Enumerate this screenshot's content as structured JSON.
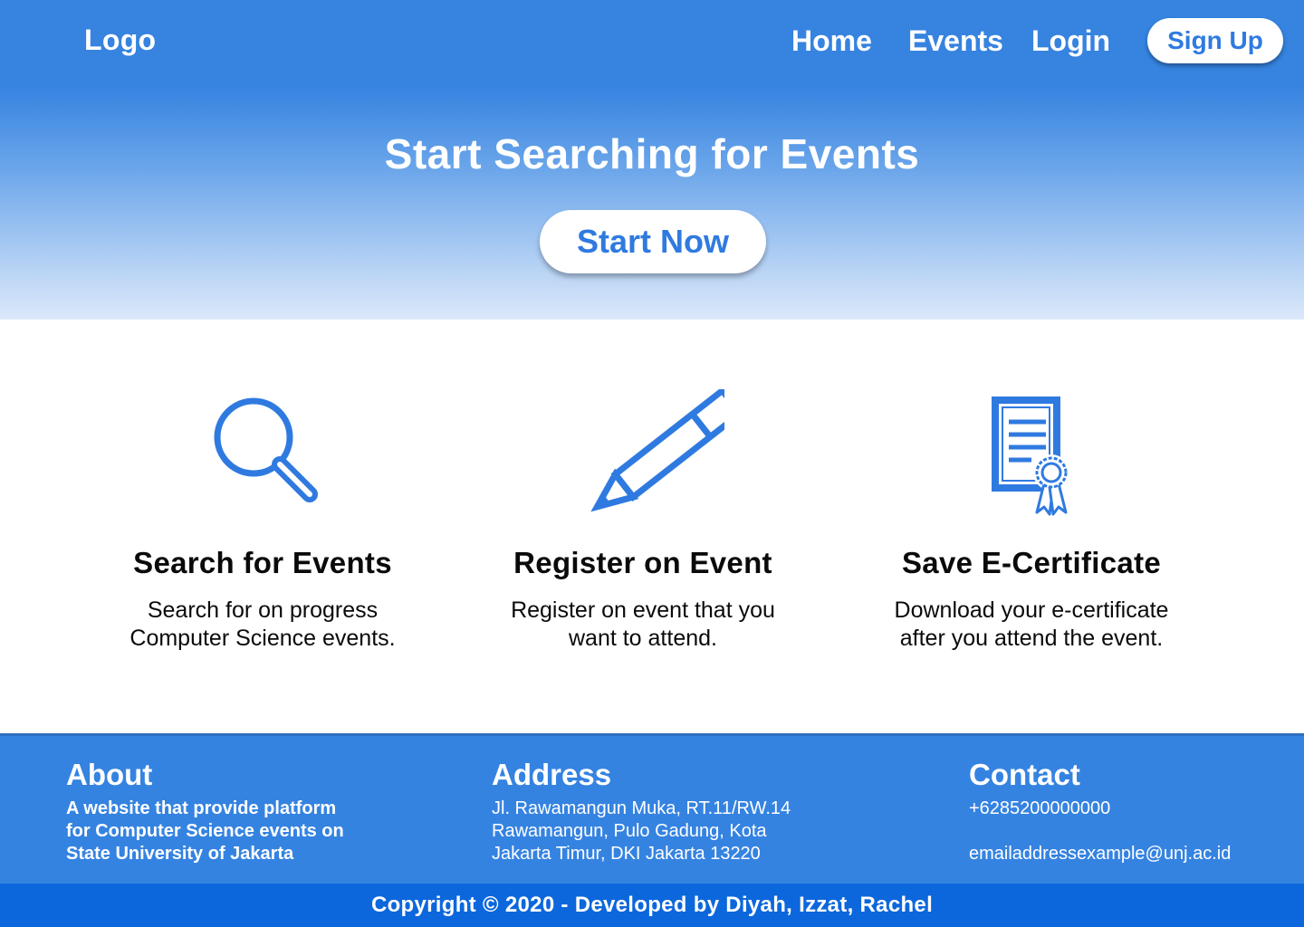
{
  "header": {
    "logo": "Logo",
    "nav": {
      "home": "Home",
      "events": "Events",
      "login": "Login"
    },
    "signup_label": "Sign Up"
  },
  "hero": {
    "title": "Start Searching for Events",
    "cta_label": "Start Now"
  },
  "features": [
    {
      "icon": "magnifier-icon",
      "title": "Search for Events",
      "desc_lines": [
        "Search for on progress",
        "Computer Science events."
      ]
    },
    {
      "icon": "pencil-icon",
      "title": "Register on Event",
      "desc_lines": [
        "Register on event that you",
        "want to attend."
      ]
    },
    {
      "icon": "certificate-icon",
      "title": "Save E-Certificate",
      "desc_lines": [
        "Download your e-certificate",
        "after you attend the event."
      ]
    }
  ],
  "footer": {
    "about": {
      "heading": "About",
      "lines": [
        "A website that provide platform",
        "for Computer Science events on",
        "State University of Jakarta"
      ]
    },
    "address": {
      "heading": "Address",
      "lines": [
        "Jl. Rawamangun Muka, RT.11/RW.14",
        "Rawamangun, Pulo Gadung, Kota",
        "Jakarta Timur, DKI Jakarta 13220"
      ]
    },
    "contact": {
      "heading": "Contact",
      "phone": "+6285200000000",
      "email": "emailaddressexample@unj.ac.id"
    }
  },
  "copyright": "Copyright © 2020 - Developed by Diyah, Izzat, Rachel",
  "colors": {
    "primary": "#3583e1",
    "copyright_bar": "#0c67dc",
    "icon": "#2f7ae0"
  }
}
